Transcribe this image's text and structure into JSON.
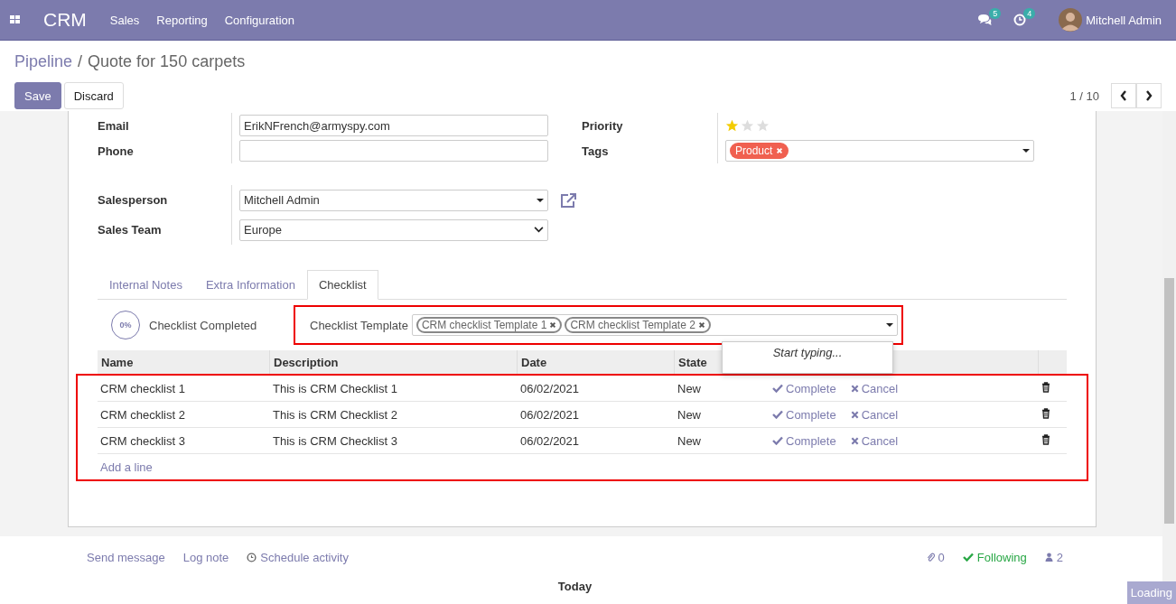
{
  "navbar": {
    "app_name": "CRM",
    "menu": [
      "Sales",
      "Reporting",
      "Configuration"
    ],
    "messages_count": "5",
    "activities_count": "4",
    "user": "Mitchell Admin"
  },
  "breadcrumb": {
    "parent": "Pipeline",
    "separator": "/",
    "current": "Quote for 150 carpets"
  },
  "buttons": [
    {
      "label": "Save",
      "kind": "primary"
    },
    {
      "label": "Discard",
      "kind": "secondary"
    }
  ],
  "pager": {
    "text": "1 / 10"
  },
  "form": {
    "left_fields": [
      {
        "label": "Email",
        "value": "ErikNFrench@armyspy.com",
        "kind": "input"
      },
      {
        "label": "Phone",
        "kind": "input"
      }
    ],
    "right_fields": [
      {
        "label": "Priority",
        "kind": "stars",
        "stars": 1
      },
      {
        "label": "Tags",
        "kind": "tags",
        "tags": [
          {
            "label": "Product",
            "color": "#f06050"
          }
        ]
      }
    ],
    "assignment_fields": [
      {
        "label": "Salesperson",
        "value": "Mitchell Admin",
        "kind": "many2one"
      },
      {
        "label": "Sales Team",
        "value": "Europe",
        "kind": "select"
      }
    ]
  },
  "tabs": [
    {
      "label": "Internal Notes",
      "selected": false
    },
    {
      "label": "Extra Information",
      "selected": false
    },
    {
      "label": "Checklist",
      "selected": true
    }
  ],
  "checklist": {
    "progress": "0%",
    "progress_label": "Checklist Completed",
    "template_label": "Checklist Template",
    "templates": [
      "CRM checklist Template 1",
      "CRM checklist Template 2"
    ],
    "dropdown_hint": "Start typing...",
    "columns": [
      "Name",
      "Description",
      "Date",
      "State"
    ],
    "rows": [
      {
        "name": "CRM checklist 1",
        "description": "This is CRM Checklist 1",
        "date": "06/02/2021",
        "state": "New",
        "complete": "Complete",
        "cancel": "Cancel"
      },
      {
        "name": "CRM checklist 2",
        "description": "This is CRM Checklist 2",
        "date": "06/02/2021",
        "state": "New",
        "complete": "Complete",
        "cancel": "Cancel"
      },
      {
        "name": "CRM checklist 3",
        "description": "This is CRM Checklist 3",
        "date": "06/02/2021",
        "state": "New",
        "complete": "Complete",
        "cancel": "Cancel"
      }
    ],
    "add_line": "Add a line"
  },
  "chatter": {
    "send_message": "Send message",
    "log_note": "Log note",
    "schedule_activity": "Schedule activity",
    "attachments": "0",
    "following": "Following",
    "followers": "2",
    "date_separator": "Today"
  },
  "loading": "Loading"
}
